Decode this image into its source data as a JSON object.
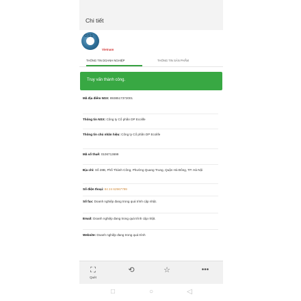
{
  "header": {
    "title": "Chi tiết"
  },
  "logo": {
    "mark": "GS1",
    "subtitle": "Vietnam"
  },
  "tabs": [
    {
      "label": "THÔNG TIN DOANH NGHIỆP",
      "active": true
    },
    {
      "label": "THÔNG TIN SẢN PHẨM",
      "active": false
    }
  ],
  "banner": {
    "text": "Truy vấn thành công."
  },
  "details": {
    "ma_dia_diem": {
      "label": "Mã địa điểm NSX:",
      "value": "8938517372001"
    },
    "thong_tin_nsx": {
      "label": "Thông tin NSX:",
      "value": "Công ty Cổ phần DP Ecolife"
    },
    "chu_nhan_hieu": {
      "label": "Thông tin chủ nhãn hiệu:",
      "value": "Công ty Cổ phần DP Ecolife"
    },
    "ma_so_thue": {
      "label": "Mã số thuế:",
      "value": "0106713699"
    },
    "dia_chi": {
      "label": "Địa chỉ:",
      "value": "Số 28B, Phố Thành Công, Phường Quang Trung, Quận Hà Đông, TP. Hà Nội"
    },
    "dien_thoai": {
      "label": "Số điện thoại:",
      "value": "84 24 62967799"
    },
    "fax": {
      "label": "Số fax:",
      "value": "Doanh nghiệp đang trong quá trình cập nhật."
    },
    "email": {
      "label": "Email:",
      "value": "Doanh nghiệp đang trong quá trình cập nhật."
    },
    "website": {
      "label": "Website:",
      "value": "Doanh nghiệp đang trong quá trình"
    }
  },
  "bottom_bar": {
    "items": [
      {
        "icon": "scan-icon",
        "label": "Quét"
      },
      {
        "icon": "history-icon",
        "label": ""
      },
      {
        "icon": "star-icon",
        "label": ""
      },
      {
        "icon": "more-icon",
        "label": ""
      }
    ]
  },
  "system_nav": {
    "buttons": [
      "back-square-icon",
      "home-circle-icon",
      "back-triangle-icon"
    ]
  }
}
